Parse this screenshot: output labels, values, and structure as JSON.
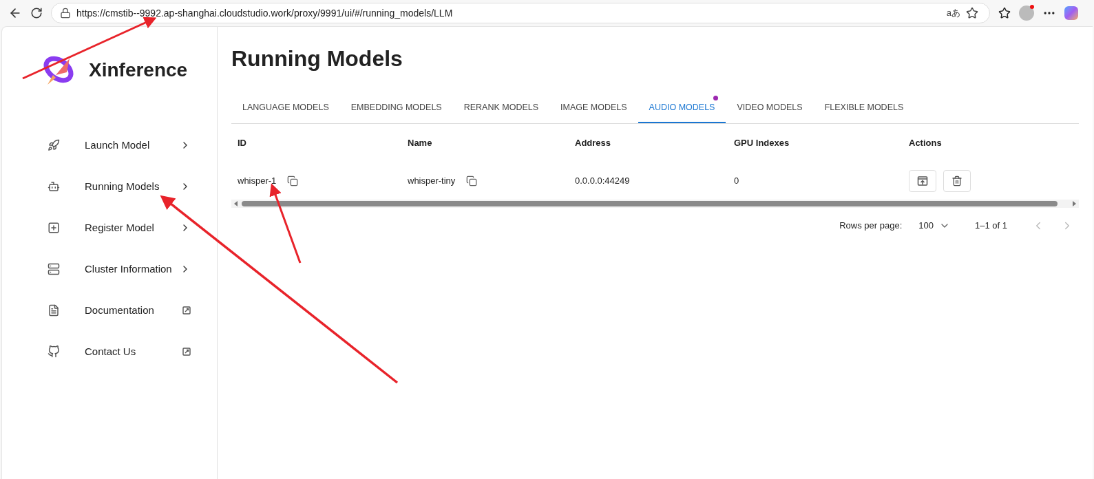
{
  "browser": {
    "url": "https://cmstib--9992.ap-shanghai.cloudstudio.work/proxy/9991/ui/#/running_models/LLM",
    "translate_glyph": "aあ"
  },
  "sidebar": {
    "brand": "Xinference",
    "items": [
      {
        "label": "Launch Model",
        "kind": "internal"
      },
      {
        "label": "Running Models",
        "kind": "internal"
      },
      {
        "label": "Register Model",
        "kind": "internal"
      },
      {
        "label": "Cluster Information",
        "kind": "internal"
      },
      {
        "label": "Documentation",
        "kind": "external"
      },
      {
        "label": "Contact Us",
        "kind": "external"
      }
    ]
  },
  "page": {
    "title": "Running Models"
  },
  "tabs": [
    {
      "label": "LANGUAGE MODELS",
      "selected": false,
      "dot": false
    },
    {
      "label": "EMBEDDING MODELS",
      "selected": false,
      "dot": false
    },
    {
      "label": "RERANK MODELS",
      "selected": false,
      "dot": false
    },
    {
      "label": "IMAGE MODELS",
      "selected": false,
      "dot": false
    },
    {
      "label": "AUDIO MODELS",
      "selected": true,
      "dot": true
    },
    {
      "label": "VIDEO MODELS",
      "selected": false,
      "dot": false
    },
    {
      "label": "FLEXIBLE MODELS",
      "selected": false,
      "dot": false
    }
  ],
  "table": {
    "columns": [
      "ID",
      "Name",
      "Address",
      "GPU Indexes",
      "Actions"
    ],
    "rows": [
      {
        "id": "whisper-1",
        "name": "whisper-tiny",
        "address": "0.0.0.0:44249",
        "gpu_indexes": "0"
      }
    ]
  },
  "pagination": {
    "rows_per_page_label": "Rows per page:",
    "rows_per_page": "100",
    "range": "1–1 of 1"
  }
}
